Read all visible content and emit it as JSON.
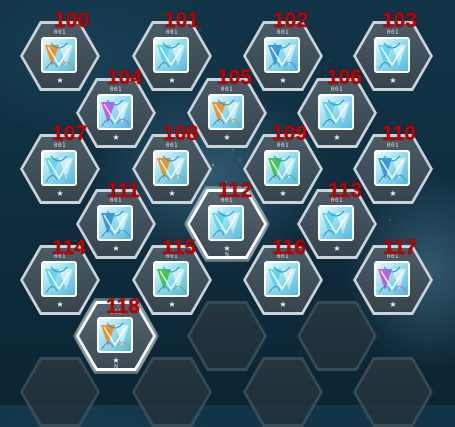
{
  "grid": {
    "slots": [
      {
        "id": "slot-100",
        "number": "100",
        "code": "001",
        "accent": "#f08a1c",
        "state": "filled"
      },
      {
        "id": "slot-101",
        "number": "101",
        "code": "001",
        "accent": "#5fd0ea",
        "state": "filled"
      },
      {
        "id": "slot-102",
        "number": "102",
        "code": "001",
        "accent": "#2f8fe0",
        "state": "filled"
      },
      {
        "id": "slot-103",
        "number": "103",
        "code": "001",
        "accent": "#5fd0ea",
        "state": "filled"
      },
      {
        "id": "slot-104",
        "number": "104",
        "code": "001",
        "accent": "#c24fe0",
        "state": "filled"
      },
      {
        "id": "slot-105",
        "number": "105",
        "code": "001",
        "accent": "#f08a1c",
        "state": "filled"
      },
      {
        "id": "slot-106",
        "number": "106",
        "code": "001",
        "accent": "#5fd0ea",
        "state": "filled"
      },
      {
        "id": "slot-107",
        "number": "107",
        "code": "001",
        "accent": "#5fd0ea",
        "state": "filled"
      },
      {
        "id": "slot-108",
        "number": "108",
        "code": "001",
        "accent": "#f08a1c",
        "state": "filled"
      },
      {
        "id": "slot-109",
        "number": "109",
        "code": "001",
        "accent": "#3cc23c",
        "state": "filled"
      },
      {
        "id": "slot-110",
        "number": "110",
        "code": "001",
        "accent": "#2f8fe0",
        "state": "filled"
      },
      {
        "id": "slot-111",
        "number": "111",
        "code": "001",
        "accent": "#2f8fe0",
        "state": "filled"
      },
      {
        "id": "slot-112",
        "number": "112",
        "code": "001",
        "accent": "#5fd0ea",
        "state": "selected",
        "mark": "N"
      },
      {
        "id": "slot-113",
        "number": "113",
        "code": "001",
        "accent": "#5fd0ea",
        "state": "filled"
      },
      {
        "id": "slot-114",
        "number": "114",
        "code": "001",
        "accent": "#5fd0ea",
        "state": "filled"
      },
      {
        "id": "slot-115",
        "number": "115",
        "code": "001",
        "accent": "#3cc23c",
        "state": "filled"
      },
      {
        "id": "slot-116",
        "number": "116",
        "code": "001",
        "accent": "#5fd0ea",
        "state": "filled"
      },
      {
        "id": "slot-117",
        "number": "117",
        "code": "001",
        "accent": "#c24fe0",
        "state": "filled"
      },
      {
        "id": "slot-118",
        "number": "118",
        "code": "001",
        "accent": "#f08a1c",
        "state": "selected",
        "mark": "N"
      }
    ],
    "empty_slots": 6,
    "star_glyph": "★",
    "colors": {
      "number_label": "#c00000",
      "selected_border": "#ffffff"
    }
  }
}
